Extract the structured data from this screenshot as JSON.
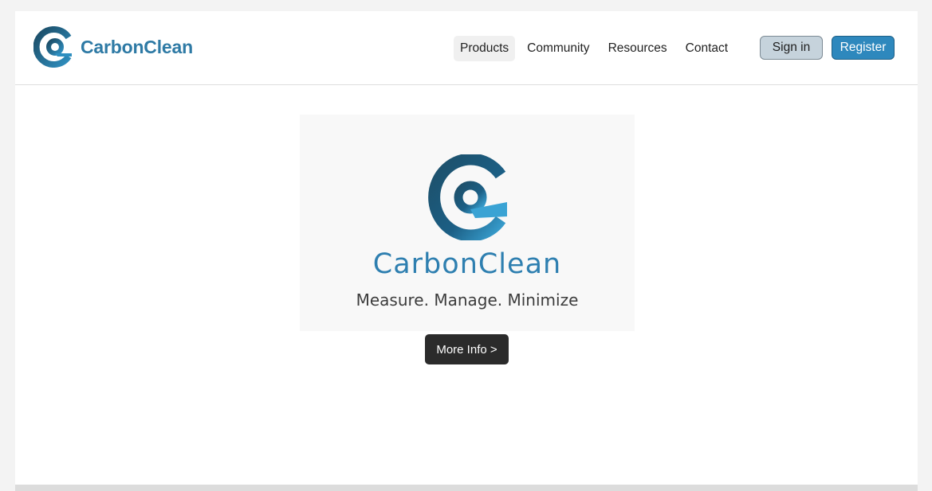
{
  "brand": {
    "name": "CarbonClean",
    "logo_icon": "carbonclean-logo-icon",
    "color": "#2e7aa5"
  },
  "nav": {
    "items": [
      {
        "label": "Products",
        "active": true
      },
      {
        "label": "Community",
        "active": false
      },
      {
        "label": "Resources",
        "active": false
      },
      {
        "label": "Contact",
        "active": false
      }
    ]
  },
  "auth": {
    "signin_label": "Sign in",
    "register_label": "Register"
  },
  "hero": {
    "title": "CarbonClean",
    "tagline": "Measure. Manage. Minimize",
    "cta_label": "More Info >"
  },
  "colors": {
    "accent": "#2e88bd",
    "dark_button": "#2b2b2b",
    "logo_dark": "#1d4f69",
    "logo_light": "#3aa3d4"
  }
}
